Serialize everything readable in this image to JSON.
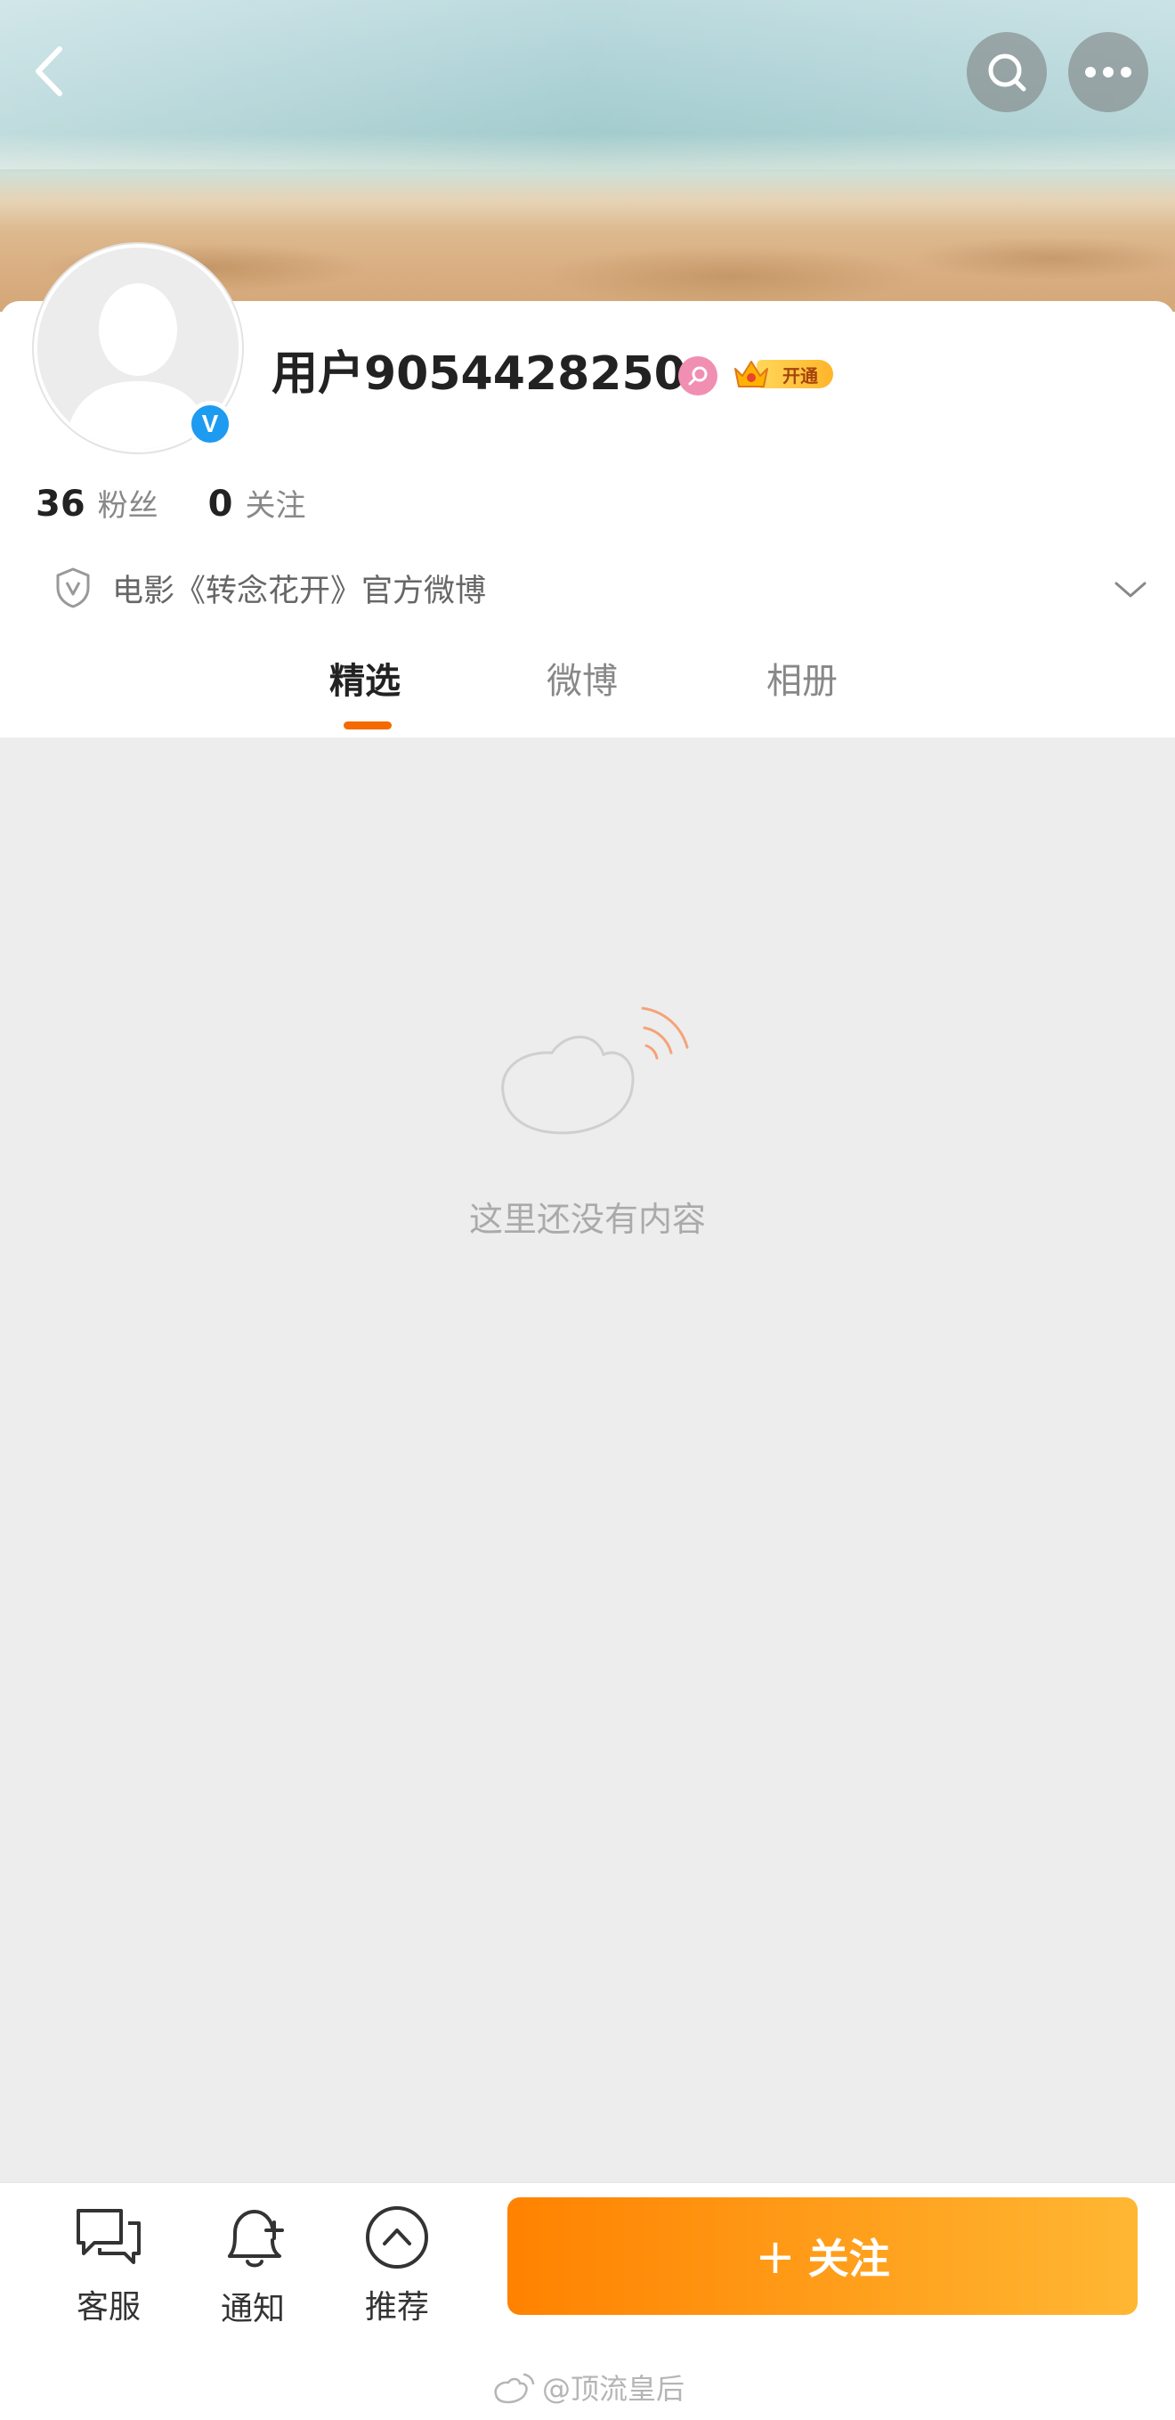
{
  "header": {
    "back_icon": "chevron-left-icon",
    "search_icon": "search-icon",
    "more_icon": "more-dots-icon"
  },
  "profile": {
    "username": "用户9054428250",
    "verified_badge": "V",
    "vip_label": "开通",
    "stats": {
      "fans_count": "36",
      "fans_label": "粉丝",
      "following_count": "0",
      "following_label": "关注"
    },
    "bio": "电影《转念花开》官方微博"
  },
  "tabs": [
    {
      "label": "精选",
      "active": true
    },
    {
      "label": "微博",
      "active": false
    },
    {
      "label": "相册",
      "active": false
    }
  ],
  "content": {
    "empty_text": "这里还没有内容"
  },
  "bottom_bar": {
    "items": [
      {
        "label": "客服",
        "icon": "chat-bubbles-icon"
      },
      {
        "label": "通知",
        "icon": "bell-plus-icon"
      },
      {
        "label": "推荐",
        "icon": "chevron-up-circle-icon"
      }
    ],
    "follow_plus": "+",
    "follow_label": "关注"
  },
  "watermark": "@顶流皇后",
  "colors": {
    "accent": "#f56a00",
    "follow_gradient_start": "#ff8200",
    "follow_gradient_end": "#ffb733",
    "verified_blue": "#1d9bf0",
    "content_bg": "#ededed"
  }
}
